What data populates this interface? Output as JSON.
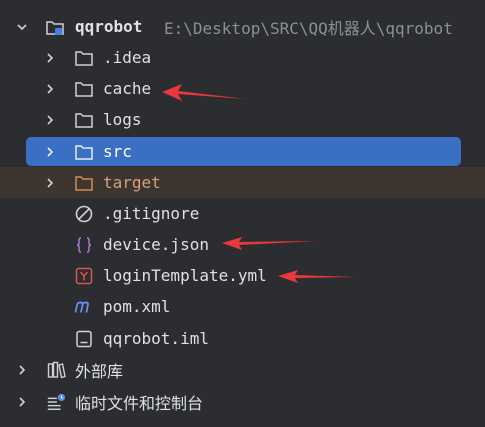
{
  "project": {
    "name": "qqrobot",
    "path": "E:\\Desktop\\SRC\\QQ机器人\\qqrobot"
  },
  "items": [
    {
      "label": ".idea",
      "kind": "folder",
      "icon": "folder-icon"
    },
    {
      "label": "cache",
      "kind": "folder",
      "icon": "folder-icon"
    },
    {
      "label": "logs",
      "kind": "folder",
      "icon": "folder-icon"
    },
    {
      "label": "src",
      "kind": "folder",
      "icon": "folder-icon",
      "selected": true
    },
    {
      "label": "target",
      "kind": "folder",
      "icon": "folder-orange-icon"
    },
    {
      "label": ".gitignore",
      "kind": "file",
      "icon": "ignore-file-icon"
    },
    {
      "label": "device.json",
      "kind": "file",
      "icon": "json-file-icon"
    },
    {
      "label": "loginTemplate.yml",
      "kind": "file",
      "icon": "yaml-file-icon"
    },
    {
      "label": "pom.xml",
      "kind": "file",
      "icon": "maven-file-icon"
    },
    {
      "label": "qqrobot.iml",
      "kind": "file",
      "icon": "iml-file-icon"
    }
  ],
  "external_libraries": {
    "label": "外部库",
    "icon": "library-icon"
  },
  "scratches": {
    "label": "临时文件和控制台",
    "icon": "scratches-icon"
  },
  "colors": {
    "background": "#2b2d30",
    "selection": "#3b6fc4",
    "annotation_arrow": "#e8383d",
    "folder_orange": "#d98a4a",
    "json_brace": "#a879d8",
    "yaml_red": "#d9534f",
    "maven_blue": "#6b8cf0"
  }
}
